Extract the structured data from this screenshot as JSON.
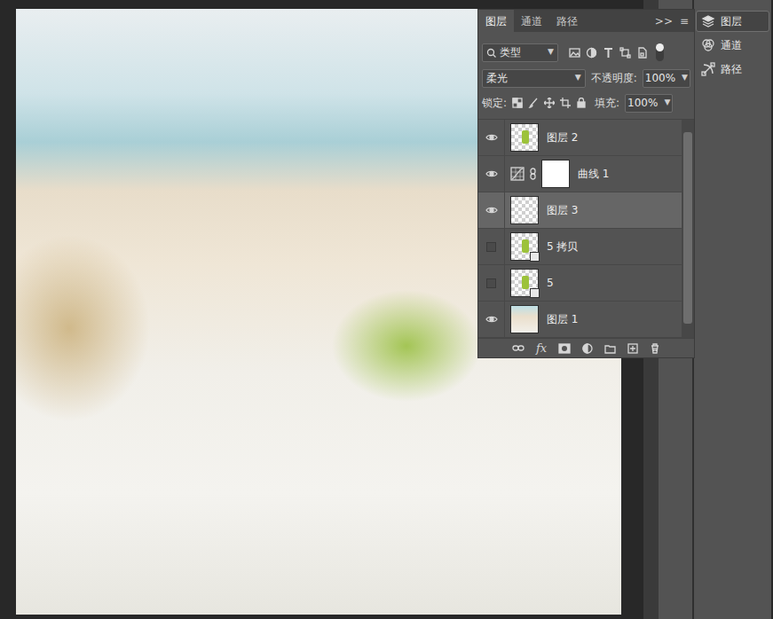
{
  "panel": {
    "tabs": [
      {
        "label": "图层",
        "selected": true
      },
      {
        "label": "通道",
        "selected": false
      },
      {
        "label": "路径",
        "selected": false
      }
    ],
    "collapse": ">>",
    "menu": "≡"
  },
  "filter": {
    "label": "类型"
  },
  "blend": {
    "mode": "柔光",
    "opacity_label": "不透明度:",
    "opacity": "100%"
  },
  "lock": {
    "label": "锁定:",
    "fill_label": "填充:",
    "fill": "100%"
  },
  "layers": [
    {
      "name": "图层 2",
      "visible": true,
      "selected": false,
      "kind": "pixel"
    },
    {
      "name": "曲线 1",
      "visible": true,
      "selected": false,
      "kind": "adjustment"
    },
    {
      "name": "图层 3",
      "visible": true,
      "selected": true,
      "kind": "empty"
    },
    {
      "name": "5 拷贝",
      "visible": false,
      "selected": false,
      "kind": "smart"
    },
    {
      "name": "5",
      "visible": false,
      "selected": false,
      "kind": "smart"
    },
    {
      "name": "图层 1",
      "visible": true,
      "selected": false,
      "kind": "photo"
    }
  ],
  "footer": {
    "fx": "fx"
  },
  "dock": [
    {
      "label": "图层",
      "selected": true
    },
    {
      "label": "通道",
      "selected": false
    },
    {
      "label": "路径",
      "selected": false
    }
  ]
}
